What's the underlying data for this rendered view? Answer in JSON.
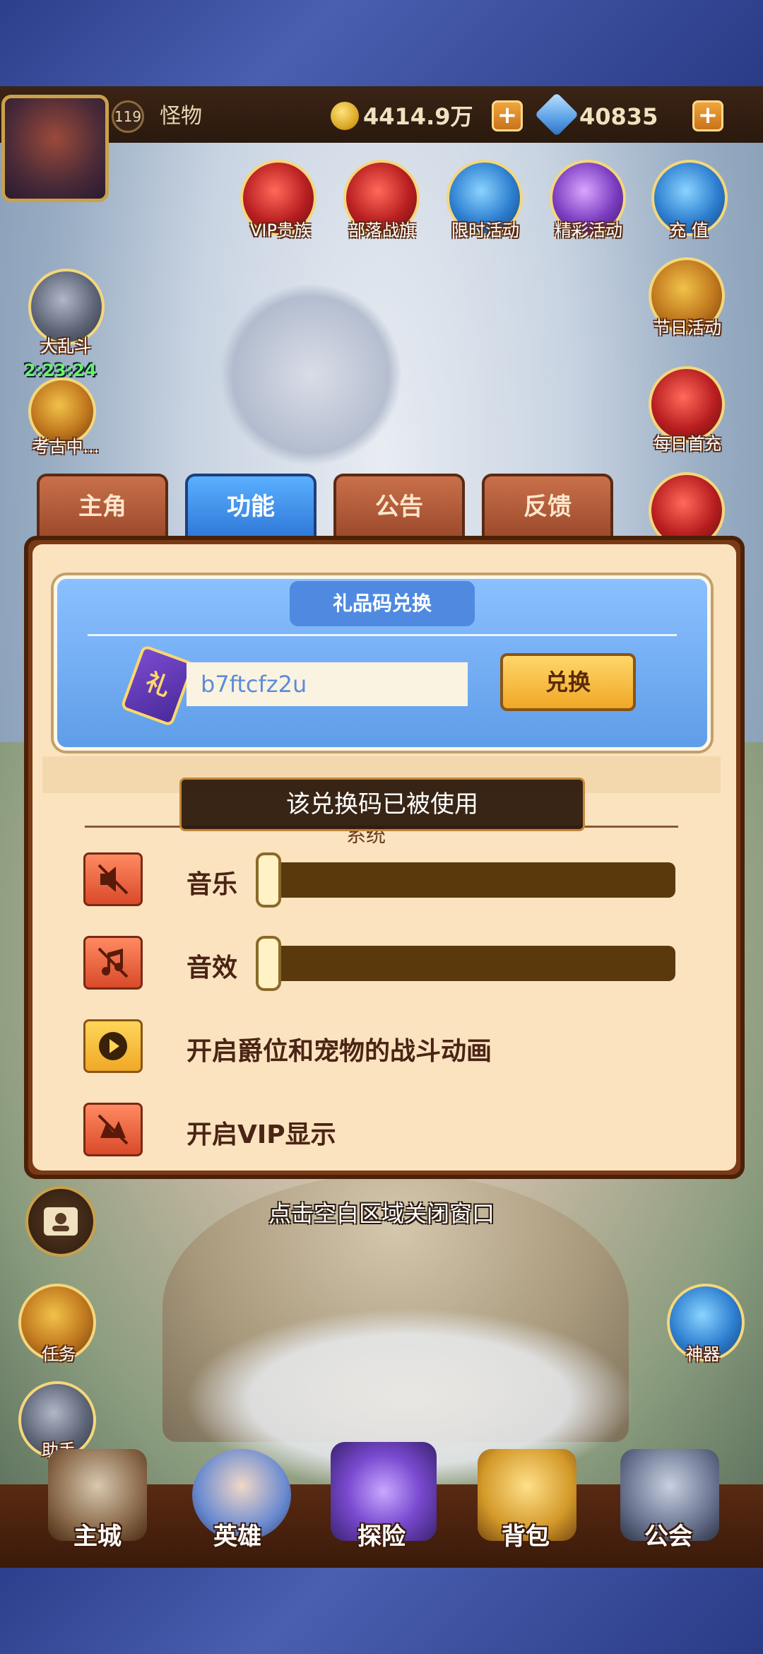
{
  "player": {
    "level": "119",
    "name": "怪物"
  },
  "resources": {
    "gold": "4414.9万",
    "gems": "40835"
  },
  "features_top": [
    {
      "label": "VIP贵族",
      "icon": "crown-icon"
    },
    {
      "label": "部落战旗",
      "icon": "war-banner-icon"
    },
    {
      "label": "限时活动",
      "icon": "compass-icon"
    },
    {
      "label": "精彩活动",
      "icon": "scroll-icon"
    },
    {
      "label": "充 值",
      "icon": "diamond-icon"
    }
  ],
  "features_right": [
    {
      "label": "节日活动",
      "icon": "treasure-chest-icon"
    },
    {
      "label": "每日首充",
      "icon": "gift-box-icon"
    }
  ],
  "features_left": [
    {
      "label": "大乱斗",
      "icon": "crossed-swords-icon"
    },
    {
      "label": "考古中...",
      "icon": "archaeology-icon"
    }
  ],
  "brawl_timer": "2:23:24",
  "tabs": [
    "主角",
    "功能",
    "公告",
    "反馈"
  ],
  "active_tab": "功能",
  "gift_code": {
    "title": "礼品码兑换",
    "ticket_char": "礼",
    "value": "b7ftcfz2u",
    "button": "兑换"
  },
  "toast": "该兑换码已被使用",
  "system_section": "系统",
  "settings": {
    "music": {
      "label": "音乐",
      "level": 0
    },
    "sfx": {
      "label": "音效",
      "level": 0
    },
    "battle_animation": {
      "label": "开启爵位和宠物的战斗动画"
    },
    "vip_display": {
      "label": "开启VIP显示"
    }
  },
  "close_hint": "点击空白区域关闭窗口",
  "side_left": [
    {
      "label": "任务"
    },
    {
      "label": "助手"
    }
  ],
  "side_right": [
    {
      "label": "神器"
    }
  ],
  "bottom_nav": [
    "主城",
    "英雄",
    "探险",
    "背包",
    "公会"
  ],
  "colors": {
    "active_tab": "#3a8ae8",
    "panel_bg": "#fbe3c0",
    "accent_gold": "#f0a826"
  }
}
